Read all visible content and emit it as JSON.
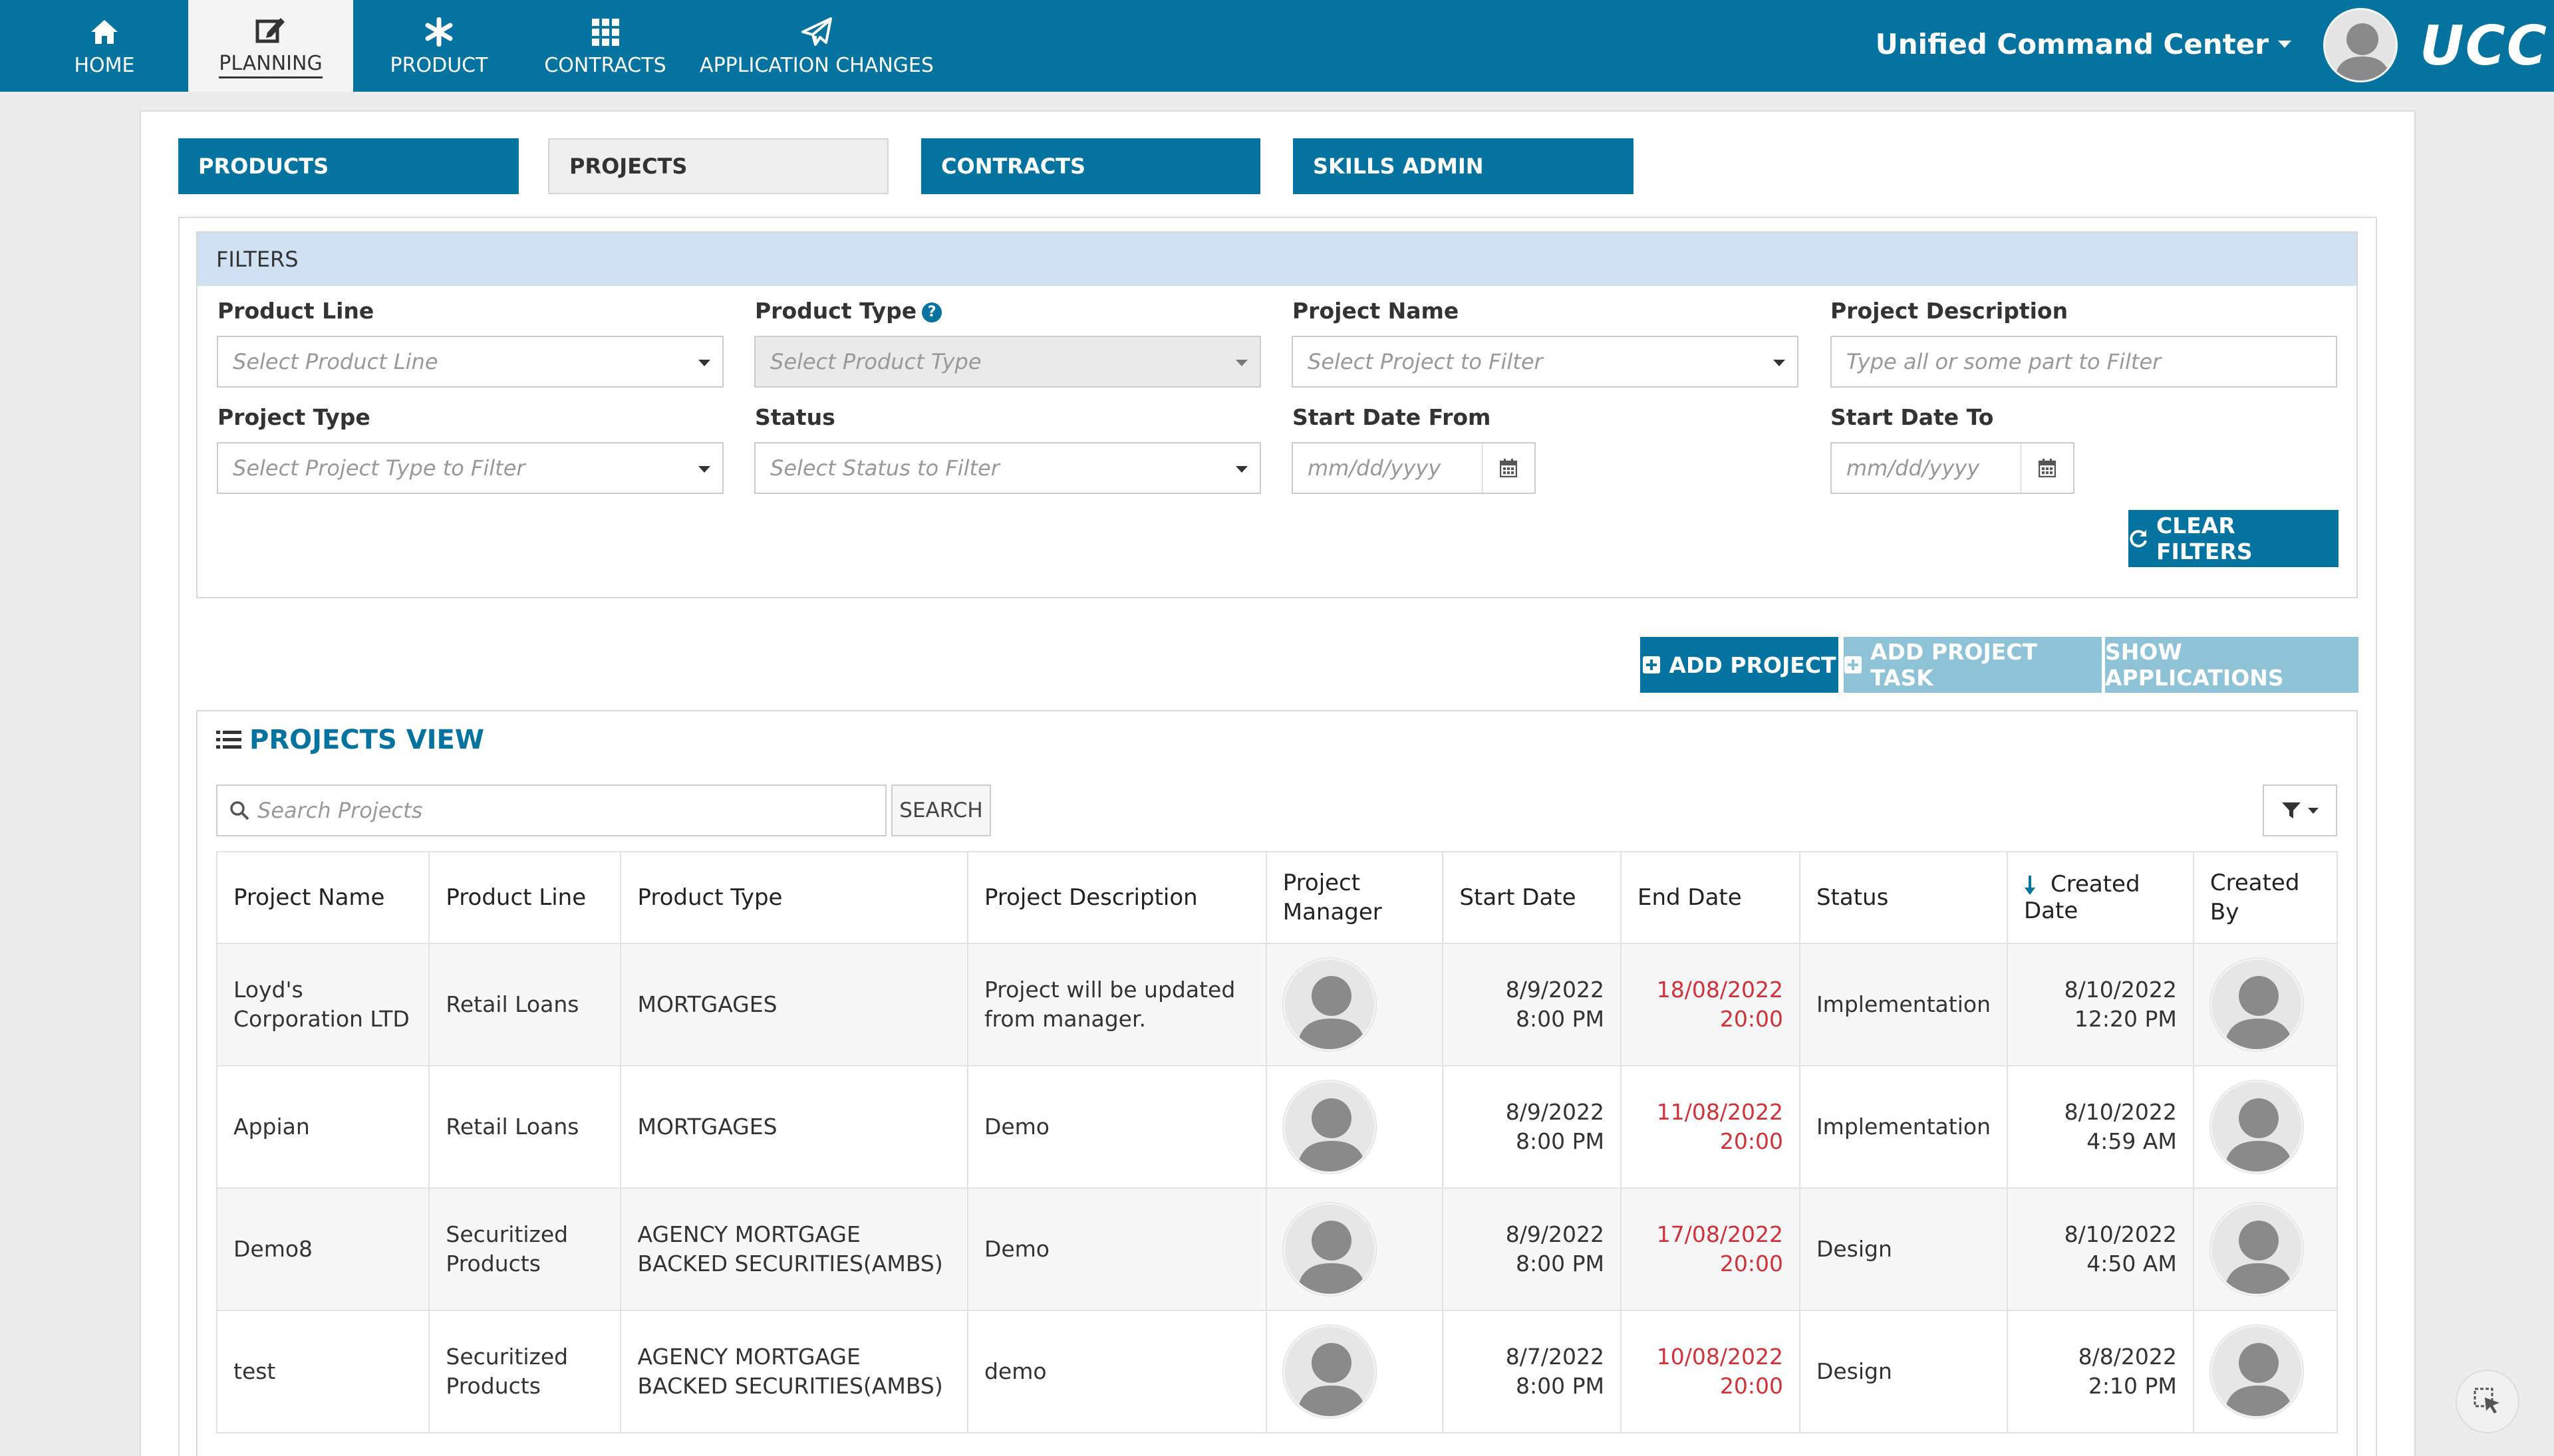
{
  "nav": {
    "tabs": [
      {
        "label": "HOME",
        "icon": "home-icon"
      },
      {
        "label": "PLANNING",
        "icon": "edit-icon"
      },
      {
        "label": "PRODUCT",
        "icon": "asterisk-icon"
      },
      {
        "label": "CONTRACTS",
        "icon": "grid-icon"
      },
      {
        "label": "APPLICATION CHANGES",
        "icon": "paper-plane-icon"
      }
    ],
    "active": "PLANNING",
    "app_title": "Unified Command Center",
    "logo": "UCC"
  },
  "subtabs": [
    "PRODUCTS",
    "PROJECTS",
    "CONTRACTS",
    "SKILLS ADMIN"
  ],
  "filters": {
    "title": "FILTERS",
    "product_line": {
      "label": "Product Line",
      "placeholder": "Select Product Line"
    },
    "product_type": {
      "label": "Product Type",
      "placeholder": "Select Product Type"
    },
    "project_name": {
      "label": "Project Name",
      "placeholder": "Select Project to Filter"
    },
    "project_description": {
      "label": "Project Description",
      "placeholder": "Type all or some part to Filter"
    },
    "project_type": {
      "label": "Project Type",
      "placeholder": "Select Project Type to Filter"
    },
    "status": {
      "label": "Status",
      "placeholder": "Select Status to Filter"
    },
    "start_date_from": {
      "label": "Start Date From",
      "placeholder": "mm/dd/yyyy"
    },
    "start_date_to": {
      "label": "Start Date To",
      "placeholder": "mm/dd/yyyy"
    },
    "clear_label": "CLEAR FILTERS"
  },
  "actions": {
    "add_project": "ADD PROJECT",
    "add_project_task": "ADD PROJECT TASK",
    "show_applications": "SHOW APPLICATIONS"
  },
  "projects_view": {
    "title": "PROJECTS VIEW",
    "search_placeholder": "Search Projects",
    "search_label": "SEARCH",
    "columns": [
      "Project Name",
      "Product Line",
      "Product Type",
      "Project Description",
      "Project Manager",
      "Start Date",
      "End Date",
      "Status",
      "Created Date",
      "Created By"
    ],
    "sorted_column": "Created Date",
    "rows": [
      {
        "name": "Loyd's Corporation LTD",
        "line": "Retail Loans",
        "type": "MORTGAGES",
        "desc": "Project will be updated from manager.",
        "start": "8/9/2022 8:00 PM",
        "end": "18/08/2022 20:00",
        "status": "Implementation",
        "created": "8/10/2022 12:20 PM"
      },
      {
        "name": "Appian",
        "line": "Retail Loans",
        "type": "MORTGAGES",
        "desc": "Demo",
        "start": "8/9/2022 8:00 PM",
        "end": "11/08/2022 20:00",
        "status": "Implementation",
        "created": "8/10/2022 4:59 AM"
      },
      {
        "name": "Demo8",
        "line": "Securitized Products",
        "type": "AGENCY MORTGAGE BACKED SECURITIES(AMBS)",
        "desc": "Demo",
        "start": "8/9/2022 8:00 PM",
        "end": "17/08/2022 20:00",
        "status": "Design",
        "created": "8/10/2022 4:50 AM"
      },
      {
        "name": "test",
        "line": "Securitized Products",
        "type": "AGENCY MORTGAGE BACKED SECURITIES(AMBS)",
        "desc": "demo",
        "start": "8/7/2022 8:00 PM",
        "end": "10/08/2022 20:00",
        "status": "Design",
        "created": "8/8/2022 2:10 PM"
      }
    ]
  },
  "colors": {
    "primary": "#04739f",
    "light_button": "#8ec2d6",
    "filter_header": "#cfe1f3",
    "overdue": "#d0323a"
  }
}
